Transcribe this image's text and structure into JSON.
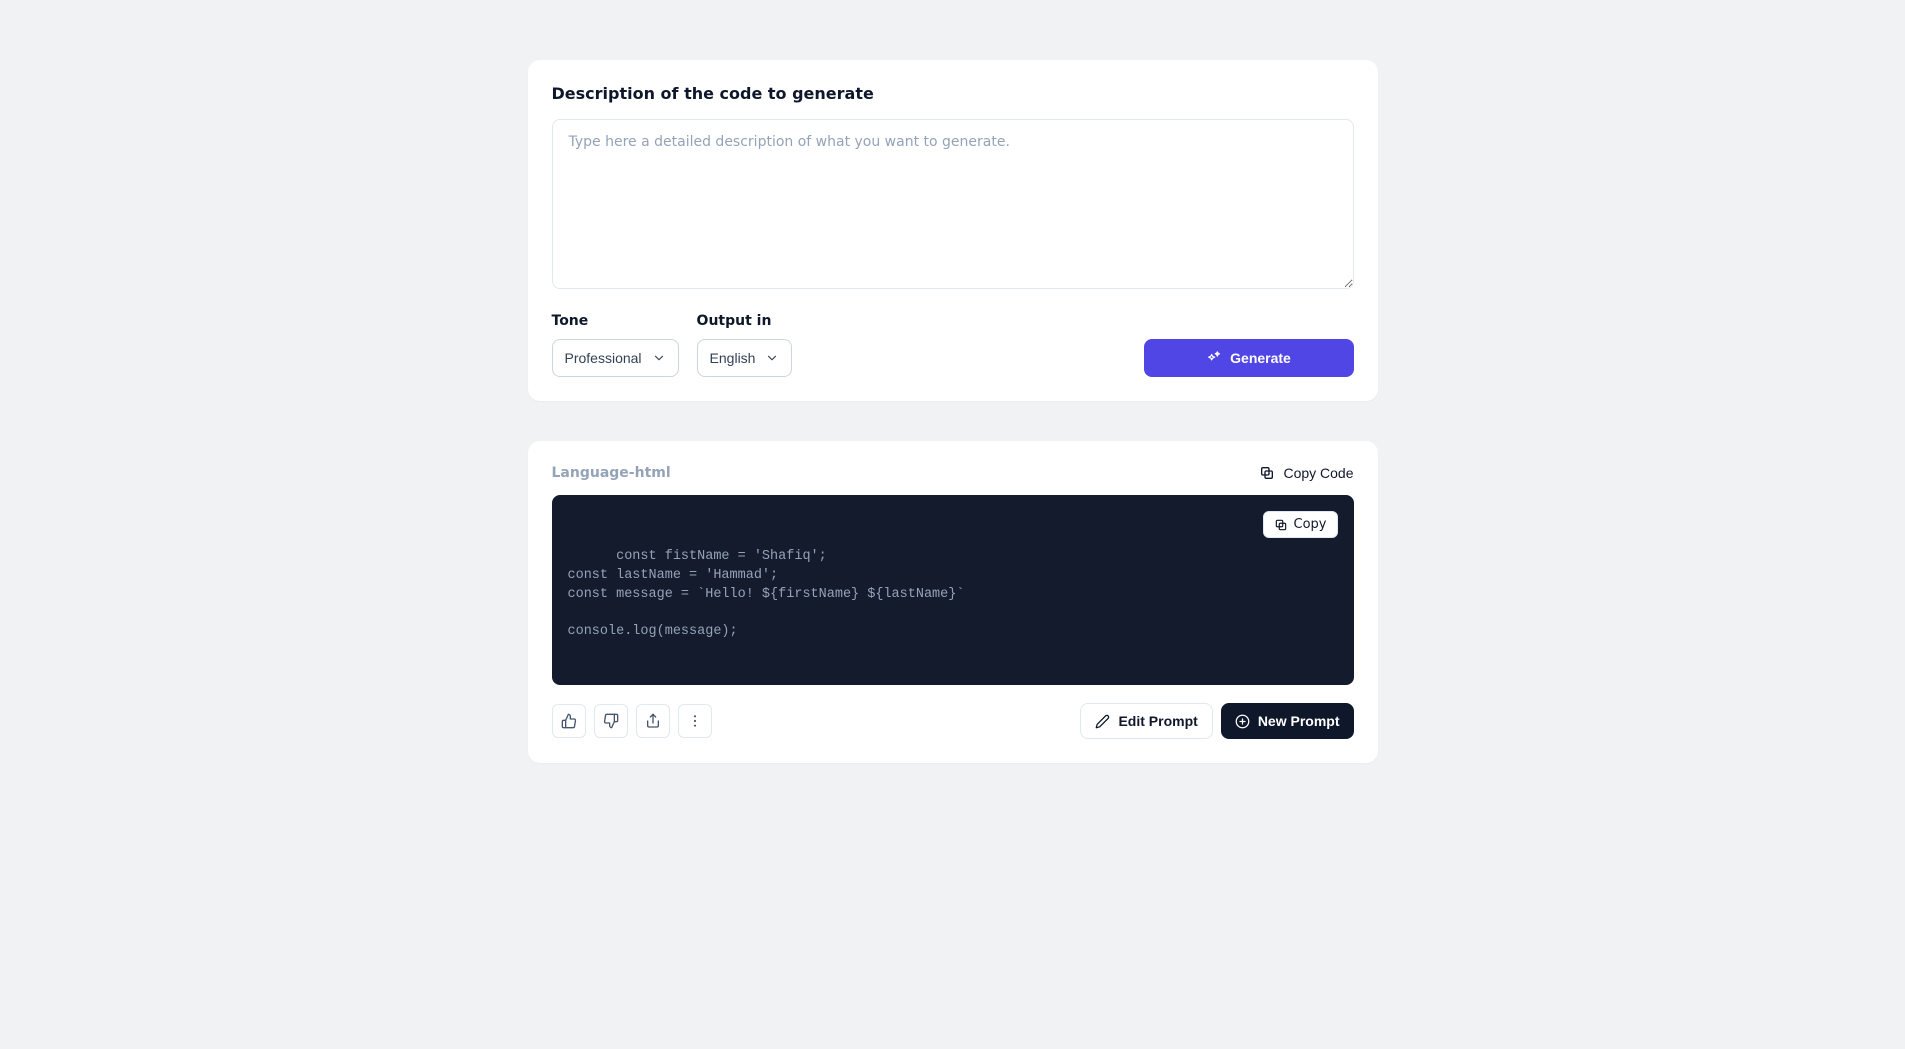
{
  "input_card": {
    "title": "Description of the code to generate",
    "description_placeholder": "Type here a detailed description of what you want to generate.",
    "description_value": "",
    "tone_label": "Tone",
    "tone_selected": "Professional",
    "output_label": "Output in",
    "output_selected": "English",
    "generate_label": "Generate"
  },
  "output_card": {
    "language_label": "Language-html",
    "copy_code_label": "Copy Code",
    "copy_badge_label": "Copy",
    "code": "const fistName = 'Shafiq';\nconst lastName = 'Hammad';\nconst message = `Hello! ${firstName} ${lastName}`\n\nconsole.log(message);",
    "edit_prompt_label": "Edit Prompt",
    "new_prompt_label": "New Prompt"
  }
}
